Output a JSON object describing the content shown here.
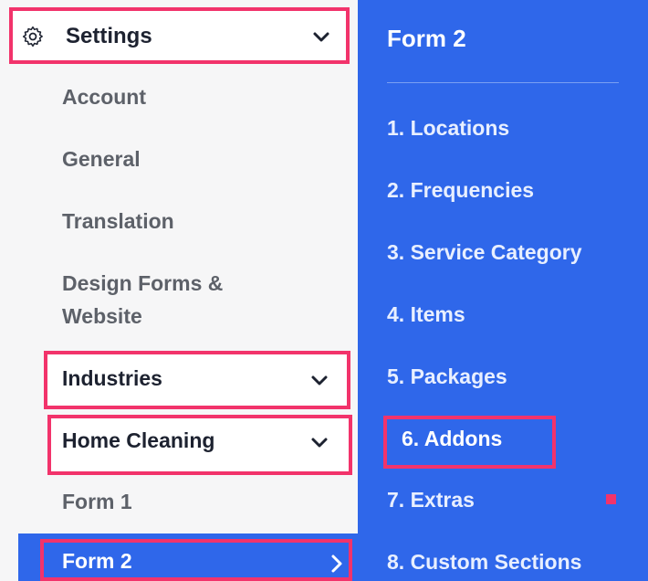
{
  "settings": {
    "label": "Settings",
    "icon": "gear-icon"
  },
  "nav": {
    "account": "Account",
    "general": "General",
    "translation": "Translation",
    "design_line1": "Design Forms &",
    "design_line2": "Website",
    "industries": "Industries",
    "home_cleaning": "Home Cleaning",
    "form1": "Form 1",
    "form2": "Form 2"
  },
  "panel": {
    "title": "Form 2",
    "items": [
      "1. Locations",
      "2. Frequencies",
      "3. Service Category",
      "4. Items",
      "5. Packages",
      "6. Addons",
      "7. Extras",
      "8. Custom Sections"
    ]
  },
  "colors": {
    "accent_blue": "#2f67ea",
    "highlight_pink": "#f2336b",
    "sidebar_bg": "#f6f6f7",
    "text_dark": "#1d2230",
    "text_muted": "#5d6169"
  }
}
